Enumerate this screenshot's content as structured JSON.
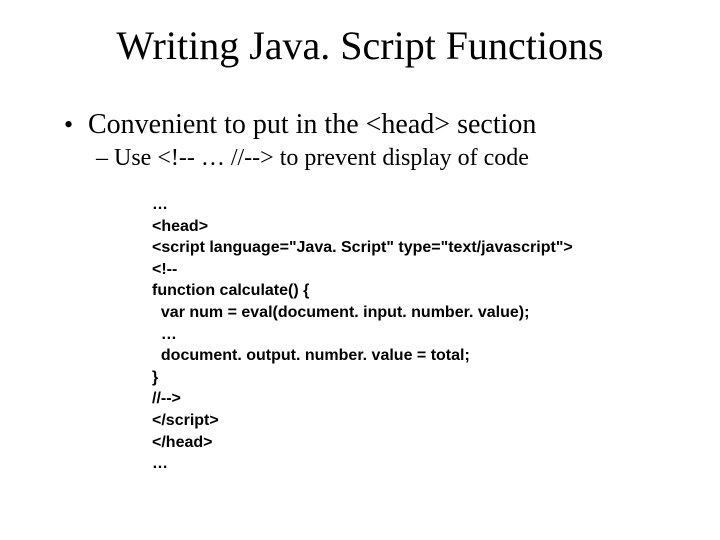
{
  "title": "Writing Java. Script Functions",
  "bullet1": "Convenient to put in the <head> section",
  "bullet2": "Use <!--  … //--> to prevent display of code",
  "code": {
    "l0": "…",
    "l1": "<head>",
    "l2": "<script language=\"Java. Script\" type=\"text/javascript\">",
    "l3": "<!--",
    "l4": "function calculate() {",
    "l5": "  var num = eval(document. input. number. value);",
    "l6": "  …",
    "l7": "  document. output. number. value = total;",
    "l8": "}",
    "l9": "//-->",
    "l10": "</script>",
    "l11": "</head>",
    "l12": "…"
  }
}
